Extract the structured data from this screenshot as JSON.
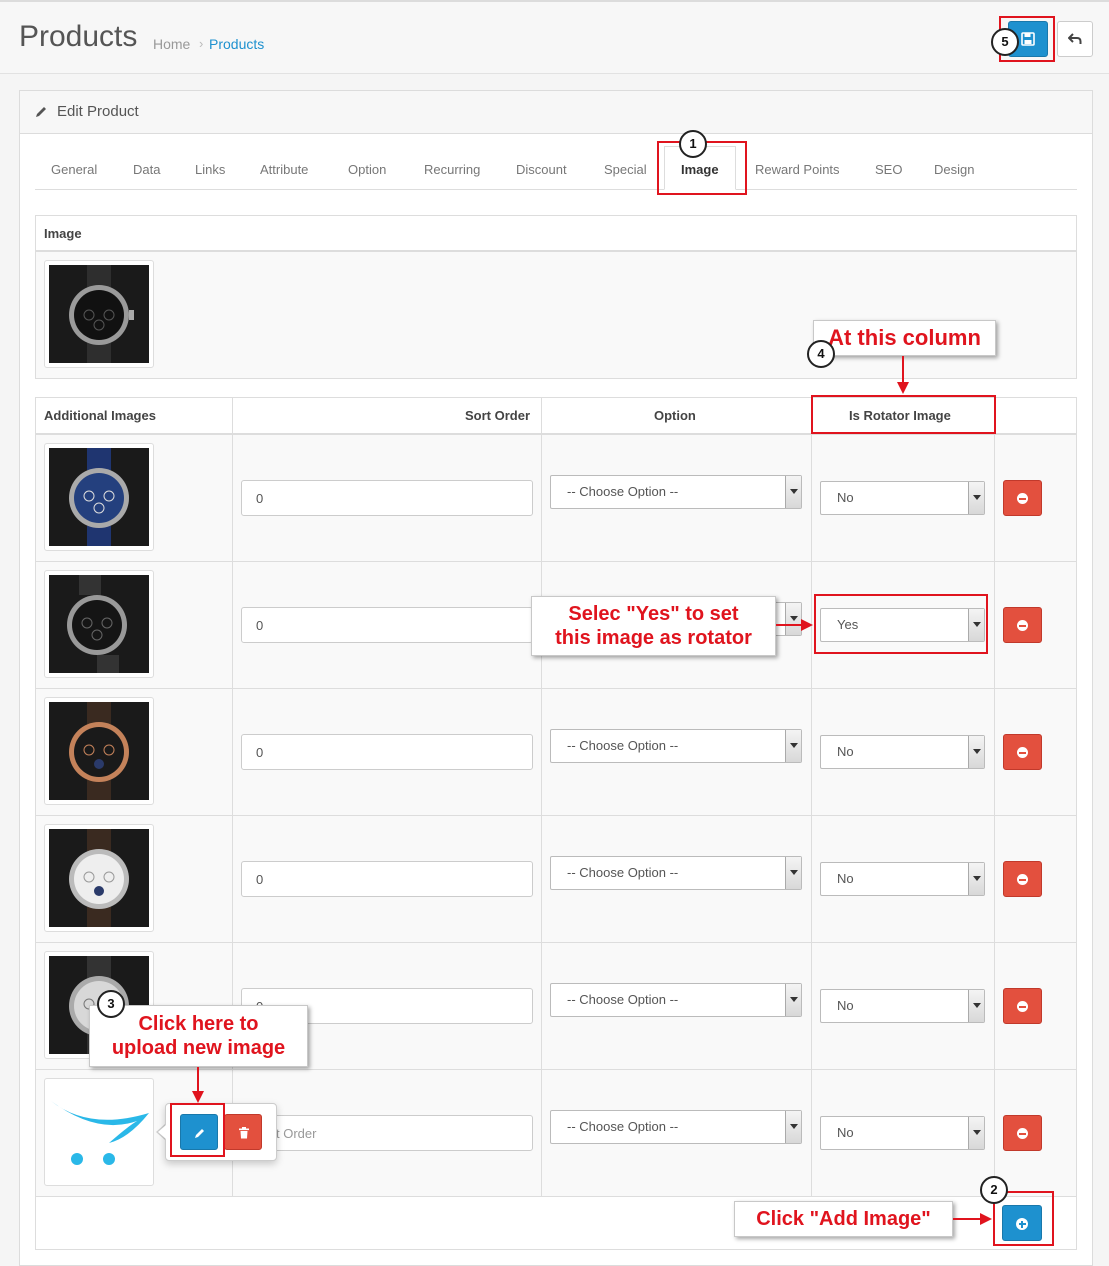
{
  "header": {
    "title": "Products",
    "breadcrumb": [
      {
        "label": "Home"
      },
      {
        "label": "Products"
      }
    ]
  },
  "panel": {
    "title": "Edit Product"
  },
  "tabs": [
    {
      "label": "General"
    },
    {
      "label": "Data"
    },
    {
      "label": "Links"
    },
    {
      "label": "Attribute"
    },
    {
      "label": "Option"
    },
    {
      "label": "Recurring"
    },
    {
      "label": "Discount"
    },
    {
      "label": "Special"
    },
    {
      "label": "Image"
    },
    {
      "label": "Reward Points"
    },
    {
      "label": "SEO"
    },
    {
      "label": "Design"
    }
  ],
  "active_tab": "Image",
  "image_section": {
    "header": "Image"
  },
  "additional": {
    "columns": [
      "Additional Images",
      "Sort Order",
      "Option",
      "Is Rotator Image"
    ],
    "rows": [
      {
        "sort_order": "0",
        "option": "-- Choose Option --",
        "rotator": "No"
      },
      {
        "sort_order": "0",
        "option": "",
        "rotator": "Yes"
      },
      {
        "sort_order": "0",
        "option": "-- Choose Option --",
        "rotator": "No"
      },
      {
        "sort_order": "0",
        "option": "-- Choose Option --",
        "rotator": "No"
      },
      {
        "sort_order": "0",
        "option": "-- Choose Option --",
        "rotator": "No"
      },
      {
        "sort_order_placeholder": "t Order",
        "option": "-- Choose Option --",
        "rotator": "No"
      }
    ]
  },
  "annotations": {
    "badges": [
      "1",
      "2",
      "3",
      "4",
      "5"
    ],
    "column_note": "At this column",
    "yes_note_line1": "Selec \"Yes\" to set",
    "yes_note_line2": "this image as rotator",
    "upload_note_line1": "Click here to",
    "upload_note_line2": "upload new image",
    "add_note": "Click \"Add Image\""
  },
  "colors": {
    "primary": "#1e91cf",
    "danger": "#e3503e",
    "annotation_red": "#e0141e"
  },
  "icons": [
    "save-icon",
    "reply-icon",
    "pencil-icon",
    "minus-circle-icon",
    "plus-circle-icon",
    "trash-icon",
    "watch-image",
    "opencart-logo"
  ]
}
